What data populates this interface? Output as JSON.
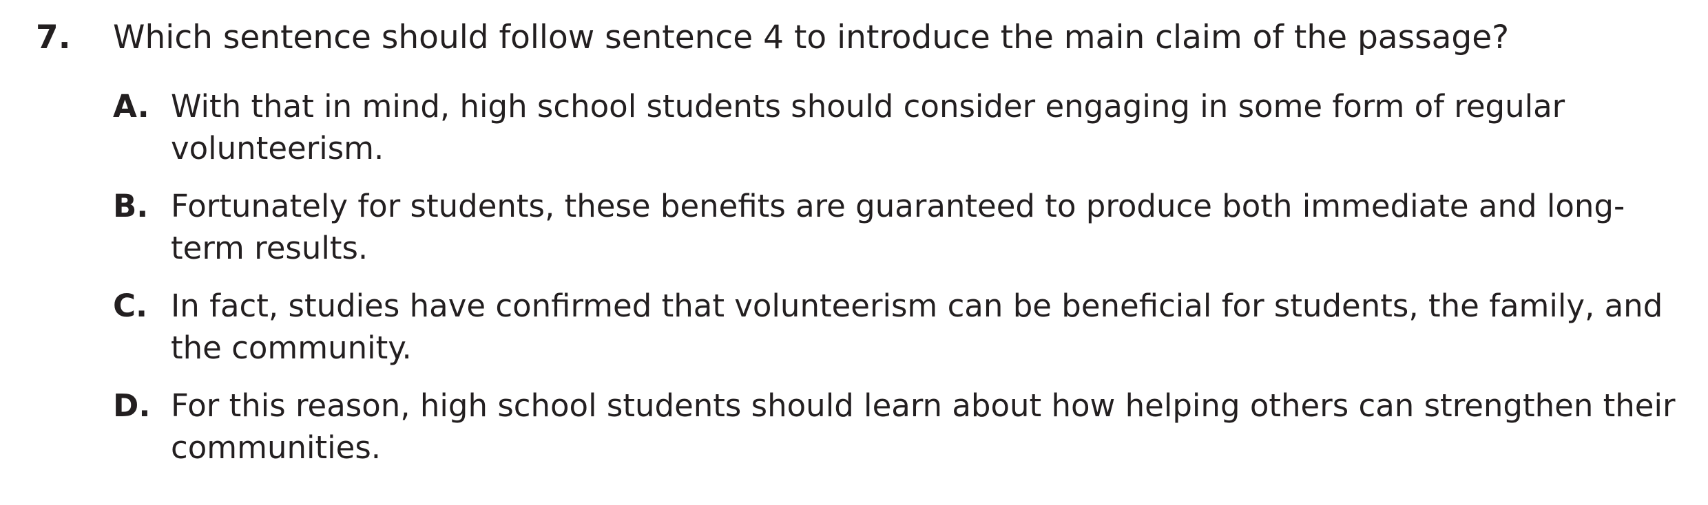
{
  "question": {
    "number": "7.",
    "text": "Which sentence should follow sentence 4 to introduce the main claim of the passage?"
  },
  "options": [
    {
      "letter": "A.",
      "text": "With that in mind, high school students should consider engaging in some form of regular volunteerism."
    },
    {
      "letter": "B.",
      "text": "Fortunately for students, these benefits are guaranteed to produce both immediate and long-term results."
    },
    {
      "letter": "C.",
      "text": "In fact, studies have confirmed that volunteerism can be beneficial for students, the family, and the community."
    },
    {
      "letter": "D.",
      "text": "For this reason, high school students should learn about how helping others can strengthen their communities."
    }
  ]
}
